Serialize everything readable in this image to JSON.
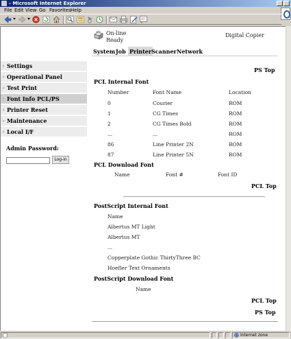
{
  "window": {
    "title": "- Microsoft Internet Explorer"
  },
  "menu": [
    "File",
    "Edit",
    "View",
    "Go",
    "Favorites",
    "Help"
  ],
  "header": {
    "status_online": "On-line",
    "status_ready": "Ready",
    "model": "Digital Copier"
  },
  "tabs": [
    "System",
    "Job",
    "Printer",
    "Scanner",
    "Network"
  ],
  "active_tab": "Printer",
  "sidebar": {
    "items": [
      {
        "label": "Settings"
      },
      {
        "label": "Operational Panel"
      },
      {
        "label": "Test Print"
      },
      {
        "label": "Font Info PCL/PS"
      },
      {
        "label": "Printer Reset"
      },
      {
        "label": "Maintenance"
      },
      {
        "label": "Local I/F"
      }
    ],
    "active_index": 3,
    "admin_label": "Admin Password:",
    "login_label": "Log-in"
  },
  "content": {
    "ps_top_link": "PS Top",
    "pcl_top_link": "PCL Top",
    "pcl_internal": {
      "heading": "PCL Internal Font",
      "columns": [
        "Number",
        "Font Name",
        "Location"
      ],
      "rows": [
        [
          "0",
          "Courier",
          "ROM"
        ],
        [
          "1",
          "CG Times",
          "ROM"
        ],
        [
          "2",
          "CG Times Bold",
          "ROM"
        ],
        [
          "...",
          "...",
          "ROM"
        ],
        [
          "86",
          "Line Printer 2N",
          "ROM"
        ],
        [
          "87",
          "Line Printer 5N",
          "ROM"
        ]
      ]
    },
    "pcl_download": {
      "heading": "PCL Download Font",
      "columns": [
        "Name",
        "Font #",
        "Font ID"
      ]
    },
    "ps_internal": {
      "heading": "PostScript Internal Font",
      "column": "Name",
      "rows": [
        "Albertus MT Light",
        "Albertus MT",
        "...",
        "Copperplate Gothic ThirtyThree BC",
        "Hoefler Text Ornaments"
      ]
    },
    "ps_download": {
      "heading": "PostScript Download Font",
      "column": "Name"
    }
  },
  "statusbar": {
    "zone": "Internet zone"
  }
}
